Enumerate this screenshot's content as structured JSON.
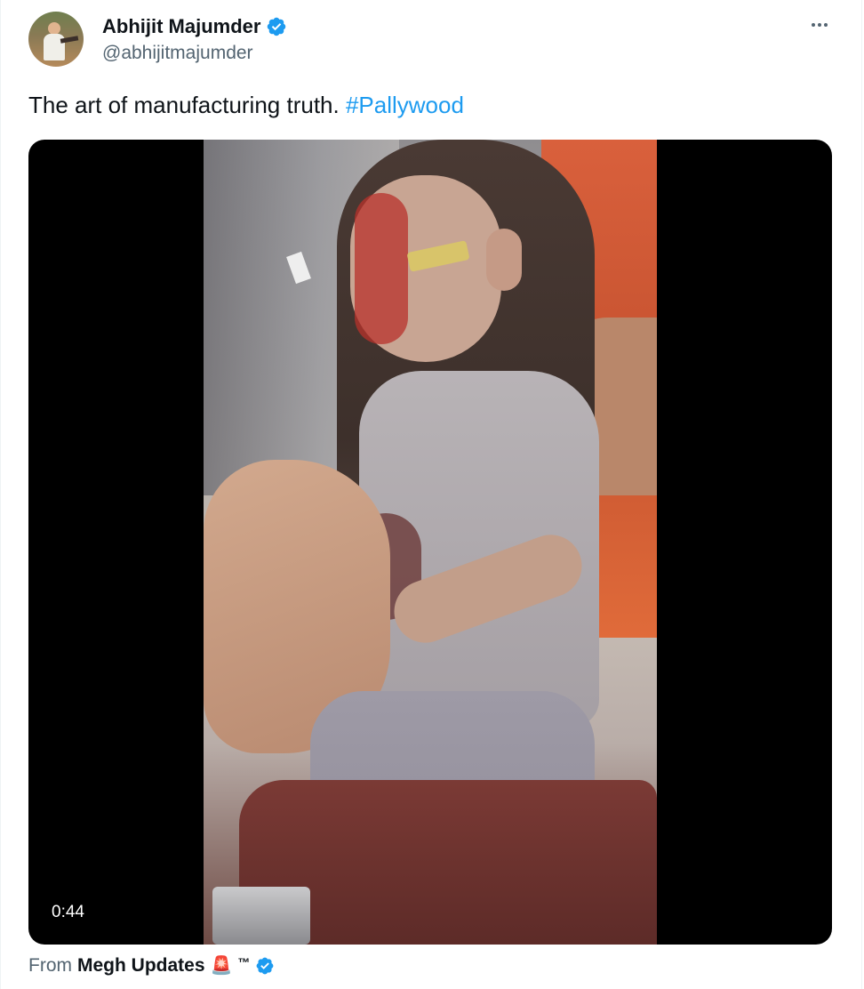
{
  "author": {
    "display_name": "Abhijit Majumder",
    "handle": "@abhijitmajumder",
    "verified": true
  },
  "tweet": {
    "text": "The art of manufacturing truth.",
    "hashtag": "#Pallywood"
  },
  "media": {
    "type": "video",
    "duration": "0:44",
    "background_color": "#000000"
  },
  "attribution": {
    "prefix": "From",
    "source_name": "Megh Updates",
    "emoji": "🚨",
    "trademark": "™",
    "verified": true
  },
  "colors": {
    "accent": "#1d9bf0",
    "text_primary": "#0f1419",
    "text_secondary": "#536471"
  },
  "icons": {
    "verified": "verified-badge-icon",
    "more": "more-horizontal-icon"
  }
}
